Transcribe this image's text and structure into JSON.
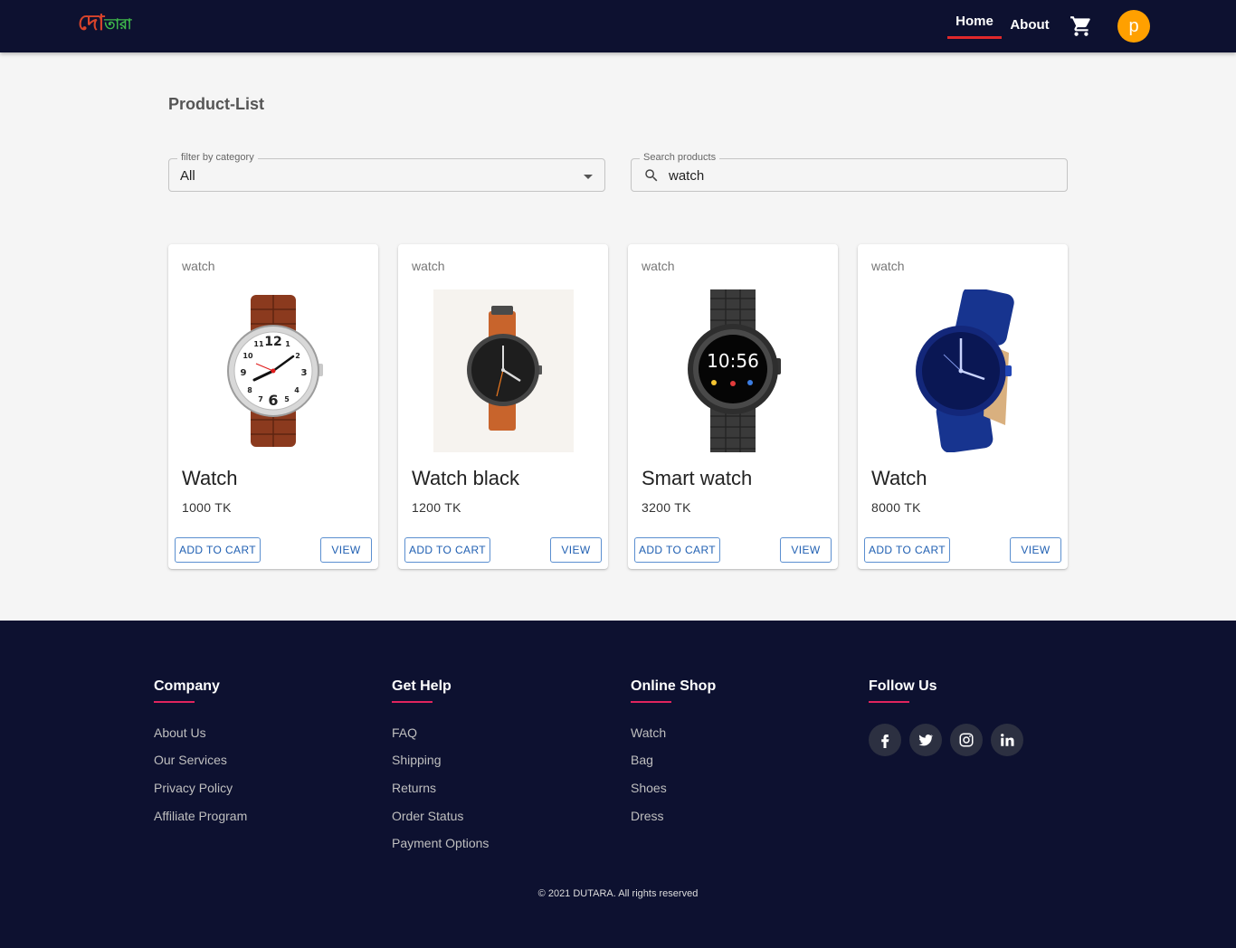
{
  "header": {
    "logo_part1": "দো",
    "logo_part2": "তারা",
    "nav": [
      {
        "label": "Home",
        "active": true
      },
      {
        "label": "About",
        "active": false
      }
    ],
    "cart_icon": "shopping-cart-icon",
    "avatar_letter": "p"
  },
  "main": {
    "title": "Product-List",
    "filter": {
      "label": "filter by category",
      "value": "All"
    },
    "search": {
      "label": "Search products",
      "value": "watch",
      "icon": "search-icon"
    }
  },
  "products": [
    {
      "category": "watch",
      "name": "Watch",
      "price": "1000 TK",
      "add_label": "ADD TO CART",
      "view_label": "VIEW"
    },
    {
      "category": "watch",
      "name": "Watch black",
      "price": "1200 TK",
      "add_label": "ADD TO CART",
      "view_label": "VIEW"
    },
    {
      "category": "watch",
      "name": "Smart watch",
      "price": "3200 TK",
      "add_label": "ADD TO CART",
      "view_label": "VIEW"
    },
    {
      "category": "watch",
      "name": "Watch",
      "price": "8000 TK",
      "add_label": "ADD TO CART",
      "view_label": "VIEW"
    }
  ],
  "smartwatch_time": "10:56",
  "footer": {
    "columns": [
      {
        "title": "Company",
        "links": [
          "About Us",
          "Our Services",
          "Privacy Policy",
          "Affiliate Program"
        ]
      },
      {
        "title": "Get Help",
        "links": [
          "FAQ",
          "Shipping",
          "Returns",
          "Order Status",
          "Payment Options"
        ]
      },
      {
        "title": "Online Shop",
        "links": [
          "Watch",
          "Bag",
          "Shoes",
          "Dress"
        ]
      },
      {
        "title": "Follow Us",
        "links": []
      }
    ],
    "social_icons": [
      "facebook-icon",
      "twitter-icon",
      "instagram-icon",
      "linkedin-icon"
    ],
    "copyright": "© 2021 DUTARA. All rights reserved"
  },
  "colors": {
    "header_bg": "#0d1130",
    "accent_red": "#e0282b",
    "avatar": "#ffa000",
    "button_text": "#1f5fb2",
    "underline_pink": "#e0245e"
  }
}
